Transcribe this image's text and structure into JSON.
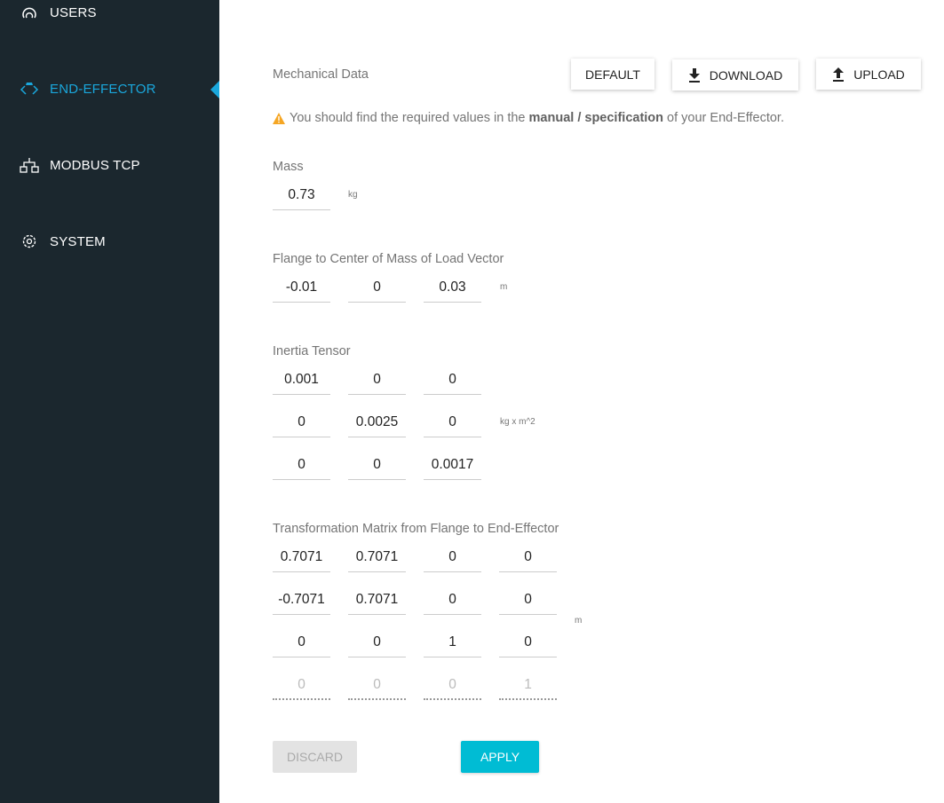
{
  "sidebar": {
    "items": [
      {
        "label": "USERS",
        "icon": "users-icon"
      },
      {
        "label": "END-EFFECTOR",
        "icon": "gripper-icon",
        "active": true
      },
      {
        "label": "MODBUS TCP",
        "icon": "network-icon"
      },
      {
        "label": "SYSTEM",
        "icon": "gear-icon"
      }
    ],
    "accent": "#1aa7dc"
  },
  "header": {
    "title": "Mechanical Data",
    "default_label": "DEFAULT",
    "download_label": "DOWNLOAD",
    "upload_label": "UPLOAD"
  },
  "warning": {
    "pre": "You should find the required values in the ",
    "bold": "manual / specification",
    "post": " of your End-Effector.",
    "icon": "warning-icon",
    "color": "#f5a623"
  },
  "mass": {
    "label": "Mass",
    "value": "0.73",
    "unit": "kg"
  },
  "load_vector": {
    "label": "Flange to Center of Mass of Load Vector",
    "values": [
      "-0.01",
      "0",
      "0.03"
    ],
    "unit": "m"
  },
  "inertia": {
    "label": "Inertia Tensor",
    "unit": "kg x m^2",
    "rows": [
      [
        "0.001",
        "0",
        "0"
      ],
      [
        "0",
        "0.0025",
        "0"
      ],
      [
        "0",
        "0",
        "0.0017"
      ]
    ]
  },
  "transform": {
    "label": "Transformation Matrix from Flange to End-Effector",
    "unit": "m",
    "rows": [
      [
        "0.7071",
        "0.7071",
        "0",
        "0"
      ],
      [
        "-0.7071",
        "0.7071",
        "0",
        "0"
      ],
      [
        "0",
        "0",
        "1",
        "0"
      ],
      [
        "0",
        "0",
        "0",
        "1"
      ]
    ]
  },
  "actions": {
    "discard_label": "DISCARD",
    "apply_label": "APPLY",
    "apply_color": "#00bcd4"
  }
}
